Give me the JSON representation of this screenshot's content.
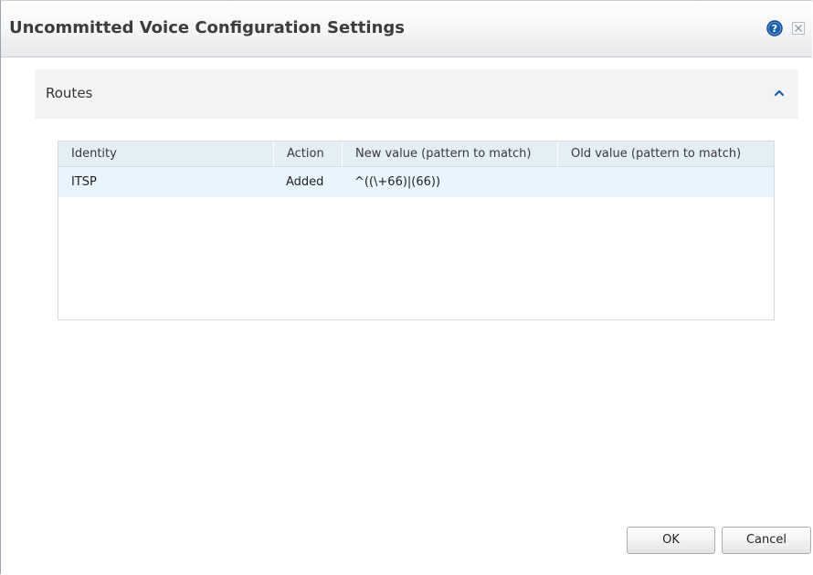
{
  "dialog": {
    "title": "Uncommitted Voice Configuration Settings"
  },
  "icons": {
    "help": "help-icon",
    "close": "close-icon",
    "collapse": "chevron-up-icon"
  },
  "section": {
    "title": "Routes"
  },
  "grid": {
    "columns": [
      "Identity",
      "Action",
      "New value (pattern to match)",
      "Old value (pattern to match)"
    ],
    "rows": [
      {
        "identity": "ITSP",
        "action": "Added",
        "new_value": "^((\\+66)|(66))",
        "old_value": ""
      }
    ]
  },
  "buttons": {
    "ok": "OK",
    "cancel": "Cancel"
  },
  "colors": {
    "accent": "#1c5fa8",
    "header_bg": "#e4eef5",
    "row_bg": "#e8f5fd"
  }
}
